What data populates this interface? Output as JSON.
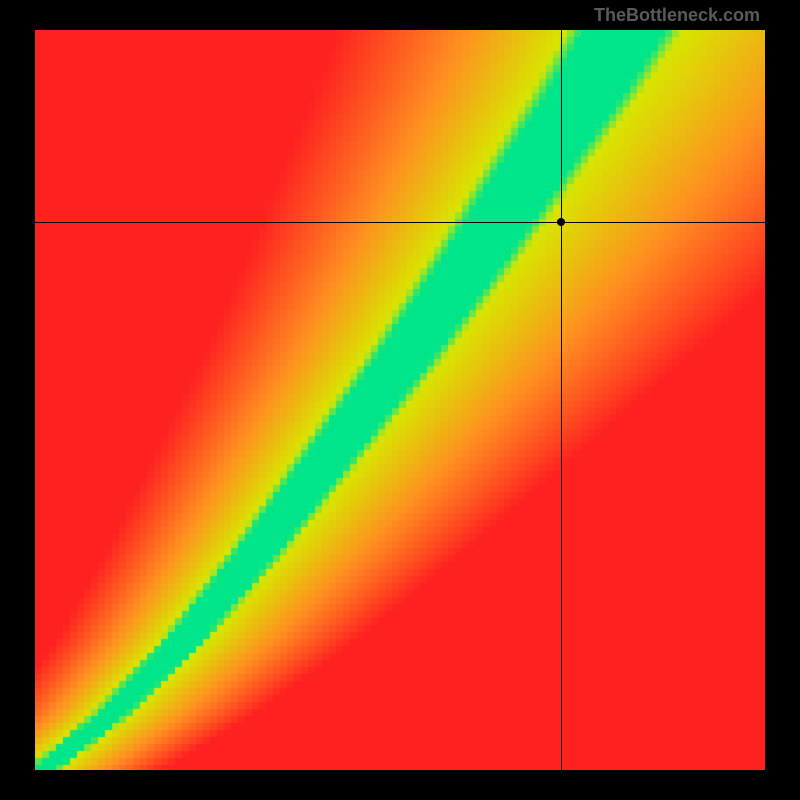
{
  "watermark": "TheBottleneck.com",
  "chart_data": {
    "type": "heatmap",
    "title": "",
    "xlabel": "",
    "ylabel": "",
    "xlim": [
      0,
      100
    ],
    "ylim": [
      0,
      100
    ],
    "crosshair": {
      "x": 72,
      "y": 74
    },
    "marker": {
      "x": 72,
      "y": 74
    },
    "optimal_curve": {
      "description": "Green band representing balanced bottleneck ratio following a superlinear curve from origin",
      "points": [
        {
          "x": 0,
          "y": 0
        },
        {
          "x": 10,
          "y": 8
        },
        {
          "x": 20,
          "y": 18
        },
        {
          "x": 30,
          "y": 30
        },
        {
          "x": 40,
          "y": 43
        },
        {
          "x": 50,
          "y": 56
        },
        {
          "x": 60,
          "y": 70
        },
        {
          "x": 68,
          "y": 82
        },
        {
          "x": 75,
          "y": 92
        },
        {
          "x": 80,
          "y": 100
        }
      ],
      "band_width": 8
    },
    "gradient_field": {
      "description": "Color gradient from green (optimal) through yellow to red (bottleneck), left side transitions red-orange-yellow, right side transitions yellow-orange-red below curve",
      "colors": {
        "optimal": "#00e589",
        "good": "#d8e500",
        "warning": "#ff9020",
        "critical": "#ff2020"
      }
    }
  }
}
